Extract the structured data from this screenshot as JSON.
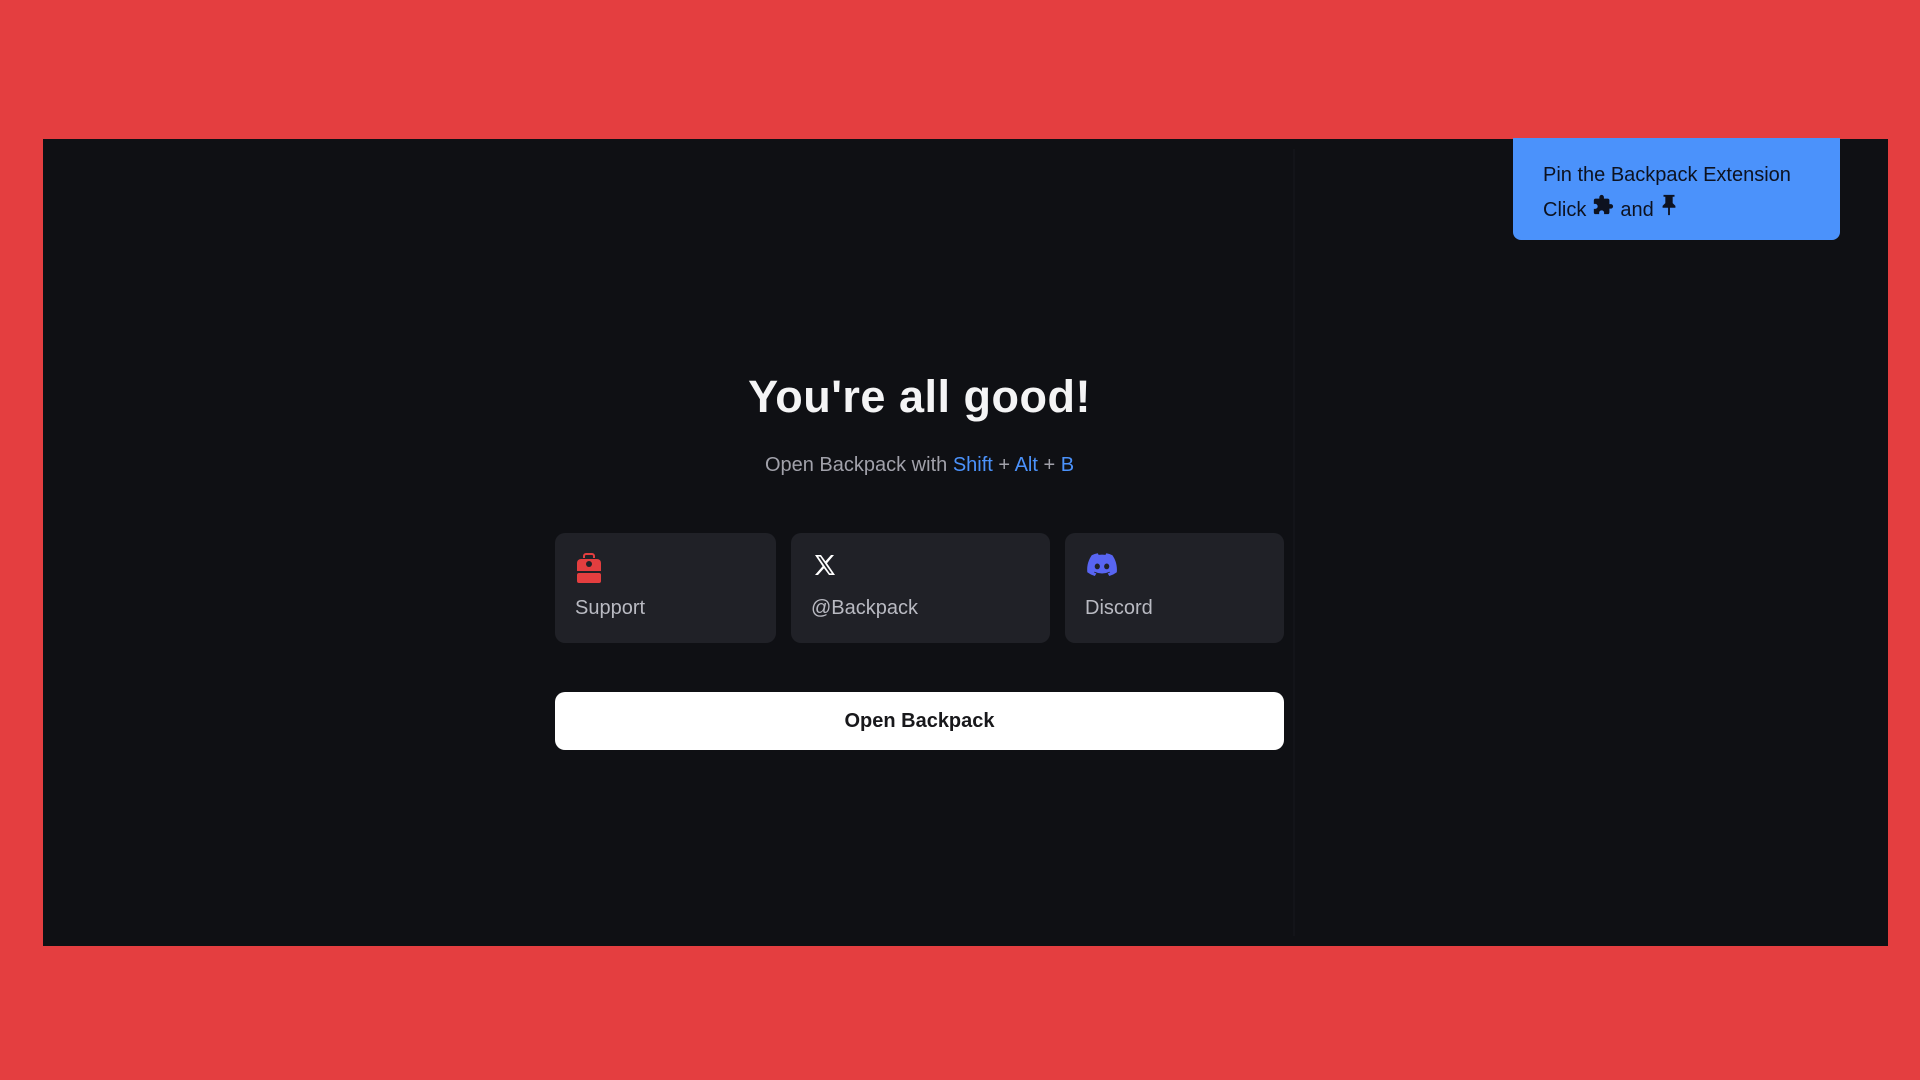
{
  "pin_callout": {
    "line1": "Pin the Backpack Extension",
    "line2_click": "Click",
    "line2_and": "and",
    "puzzle_icon": "puzzle-icon",
    "pin_icon": "pushpin-icon"
  },
  "main": {
    "title": "You're all good!",
    "subtitle_prefix": "Open Backpack with",
    "keys": [
      "Shift",
      "Alt",
      "B"
    ],
    "plus": "+"
  },
  "cards": [
    {
      "label": "Support",
      "icon": "backpack-icon",
      "icon_color": "#e33e3f"
    },
    {
      "label": "@Backpack",
      "icon": "x-logo-icon",
      "icon_color": "#ffffff"
    },
    {
      "label": "Discord",
      "icon": "discord-icon",
      "icon_color": "#5865f2"
    }
  ],
  "open_button": {
    "label": "Open Backpack"
  },
  "colors": {
    "frame": "#e43e40",
    "window": "#0f1014",
    "card": "#202127",
    "accent": "#4b92fb"
  }
}
